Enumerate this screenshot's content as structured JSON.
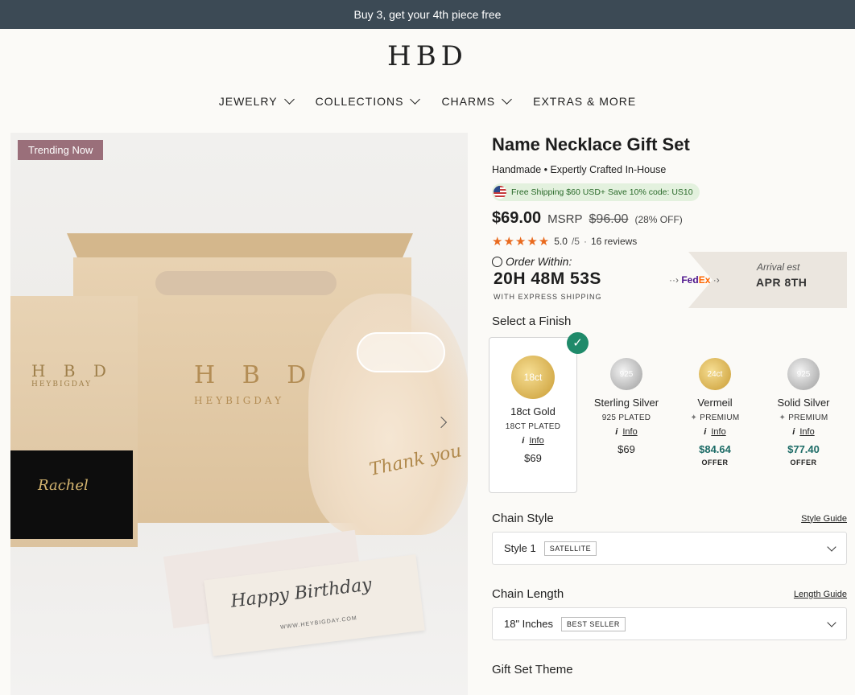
{
  "announcement": "Buy 3, get your 4th piece free",
  "logo": "HBD",
  "nav": [
    {
      "label": "JEWELRY",
      "has_dropdown": true
    },
    {
      "label": "COLLECTIONS",
      "has_dropdown": true
    },
    {
      "label": "CHARMS",
      "has_dropdown": true
    },
    {
      "label": "EXTRAS & MORE",
      "has_dropdown": false
    }
  ],
  "gallery": {
    "badge": "Trending Now",
    "bag_brand": "H B D",
    "bag_sub": "HEYBIGDAY",
    "box_brand": "H B D",
    "box_sub": "HEYBIGDAY",
    "necklace_name": "Rachel",
    "cookie_text": "Thank you",
    "card_text": "Happy Birthday",
    "card_url": "WWW.HEYBIGDAY.COM"
  },
  "product": {
    "title": "Name Necklace Gift Set",
    "subtitle": "Handmade • Expertly Crafted In-House",
    "shipping_promo": "Free Shipping $60 USD+ Save 10% code: US10",
    "price": "$69.00",
    "msrp_label": "MSRP",
    "msrp": "$96.00",
    "discount": "(28% OFF)",
    "rating": "5.0",
    "rating_scale": "/5",
    "reviews": "16 reviews",
    "stars": 5
  },
  "order": {
    "label": "Order Within:",
    "countdown": "20H 48M 53S",
    "method": "WITH EXPRESS SHIPPING",
    "arrival_label": "Arrival est",
    "arrival_date": "APR 8TH",
    "carrier_fed": "Fed",
    "carrier_ex": "Ex"
  },
  "finish": {
    "label": "Select a Finish",
    "options": [
      {
        "name": "18ct Gold",
        "badge": "18ct",
        "sub": "18CT PLATED",
        "info": "Info",
        "price": "$69",
        "offer": ""
      },
      {
        "name": "Sterling Silver",
        "badge": "925",
        "sub": "925 PLATED",
        "info": "Info",
        "price": "$69",
        "offer": ""
      },
      {
        "name": "Vermeil",
        "badge": "24ct",
        "sub": "PREMIUM",
        "info": "Info",
        "price": "$84.64",
        "offer": "OFFER"
      },
      {
        "name": "Solid Silver",
        "badge": "925",
        "sub": "PREMIUM",
        "info": "Info",
        "price": "$77.40",
        "offer": "OFFER"
      }
    ]
  },
  "chain_style": {
    "label": "Chain Style",
    "guide": "Style Guide",
    "value": "Style 1",
    "tag": "SATELLITE"
  },
  "chain_length": {
    "label": "Chain Length",
    "guide": "Length Guide",
    "value": "18\" Inches",
    "tag": "BEST SELLER"
  },
  "gift_theme": {
    "label": "Gift Set Theme"
  }
}
